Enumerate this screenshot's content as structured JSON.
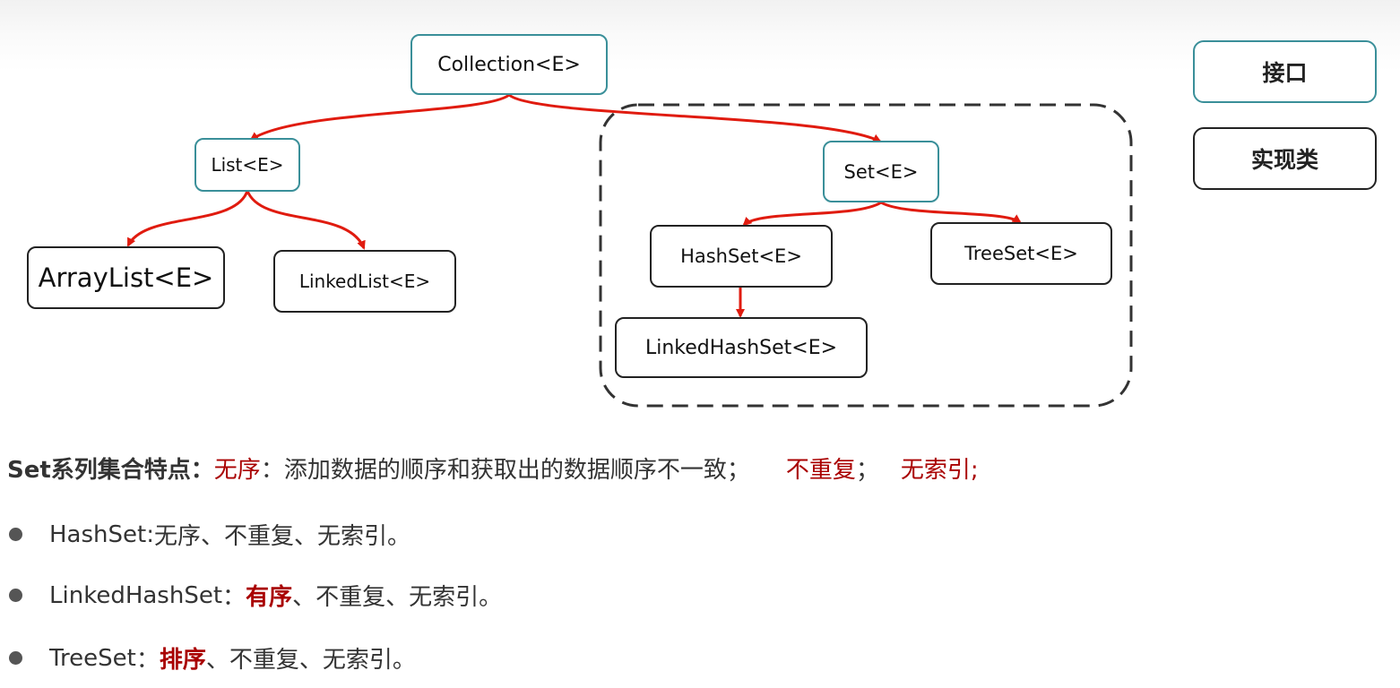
{
  "diagram": {
    "nodes": {
      "collection": "Collection<E>",
      "list": "List<E>",
      "set": "Set<E>",
      "arraylist": "ArrayList<E>",
      "linkedlist": "LinkedList<E>",
      "hashset": "HashSet<E>",
      "treeset": "TreeSet<E>",
      "linkedhashset": "LinkedHashSet<E>"
    },
    "arrow_color": "#e01b0f",
    "interface_border_color": "#3a8f99",
    "impl_border_color": "#222222"
  },
  "legend": {
    "interface_label": "接口",
    "impl_label": "实现类"
  },
  "summary": {
    "lead": "Set系列集合特点：",
    "unordered": "无序",
    "unordered_desc": "：添加数据的顺序和获取出的数据顺序不一致；",
    "no_duplicate": "不重复",
    "sep": "；",
    "no_index": "无索引;"
  },
  "bullets": [
    {
      "name": "HashSet",
      "sep": " : ",
      "highlight": "",
      "rest": "无序、不重复、无索引。"
    },
    {
      "name": "LinkedHashSet",
      "sep": "：",
      "highlight": "有序",
      "rest": "、不重复、无索引。"
    },
    {
      "name": "TreeSet",
      "sep": "：",
      "highlight": "排序",
      "rest": "、不重复、无索引。"
    }
  ],
  "accent_red": "#a90000"
}
